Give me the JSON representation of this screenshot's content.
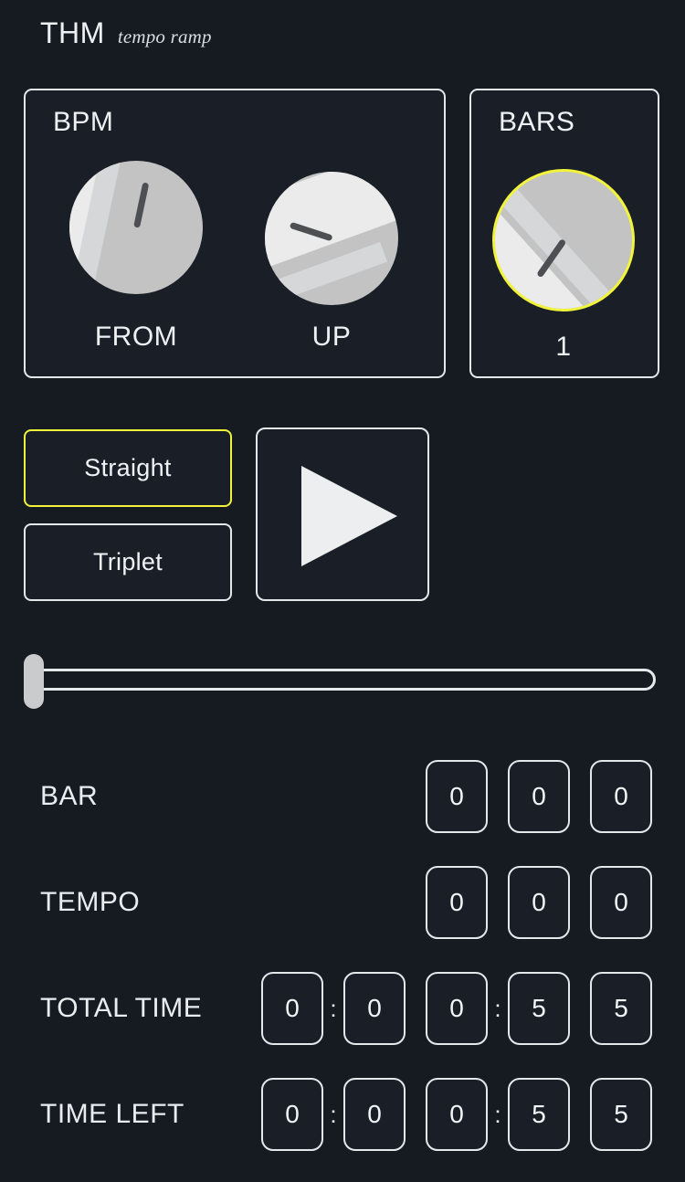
{
  "header": {
    "title": "THM",
    "subtitle": "tempo ramp"
  },
  "colors": {
    "background": "#161b22",
    "panel": "#1a1f27",
    "border": "#e4e8eb",
    "text": "#e9edf0",
    "accent_yellow": "#f1f43a",
    "knob_base": "#c3c3c3",
    "knob_highlight": "#ebebeb",
    "knob_pointer": "#4d4f52"
  },
  "bpm_panel": {
    "title": "BPM",
    "knobs": [
      {
        "label": "FROM",
        "selected": false
      },
      {
        "label": "UP",
        "selected": false
      }
    ]
  },
  "bars_panel": {
    "title": "BARS",
    "knob": {
      "value": "1",
      "selected": true
    }
  },
  "mode_buttons": [
    {
      "label": "Straight",
      "selected": true
    },
    {
      "label": "Triplet",
      "selected": false
    }
  ],
  "transport": {
    "play_icon": "play-triangle-icon"
  },
  "slider": {
    "icon": "slider-thumb-handle",
    "position_percent": 0
  },
  "readouts": [
    {
      "label": "BAR",
      "cells": [
        {
          "kind": "digit",
          "value": "0"
        },
        {
          "kind": "digit",
          "value": "0"
        },
        {
          "kind": "digit",
          "value": "0"
        }
      ]
    },
    {
      "label": "TEMPO",
      "cells": [
        {
          "kind": "digit",
          "value": "0"
        },
        {
          "kind": "digit",
          "value": "0"
        },
        {
          "kind": "digit",
          "value": "0"
        }
      ]
    },
    {
      "label": "TOTAL TIME",
      "cells": [
        {
          "kind": "digit",
          "value": "0"
        },
        {
          "kind": "sep",
          "value": ":"
        },
        {
          "kind": "digit",
          "value": "0"
        },
        {
          "kind": "digit",
          "value": "0"
        },
        {
          "kind": "sep",
          "value": ":"
        },
        {
          "kind": "digit",
          "value": "5"
        },
        {
          "kind": "digit",
          "value": "5"
        }
      ]
    },
    {
      "label": "TIME LEFT",
      "cells": [
        {
          "kind": "digit",
          "value": "0"
        },
        {
          "kind": "sep",
          "value": ":"
        },
        {
          "kind": "digit",
          "value": "0"
        },
        {
          "kind": "digit",
          "value": "0"
        },
        {
          "kind": "sep",
          "value": ":"
        },
        {
          "kind": "digit",
          "value": "5"
        },
        {
          "kind": "digit",
          "value": "5"
        }
      ]
    }
  ]
}
